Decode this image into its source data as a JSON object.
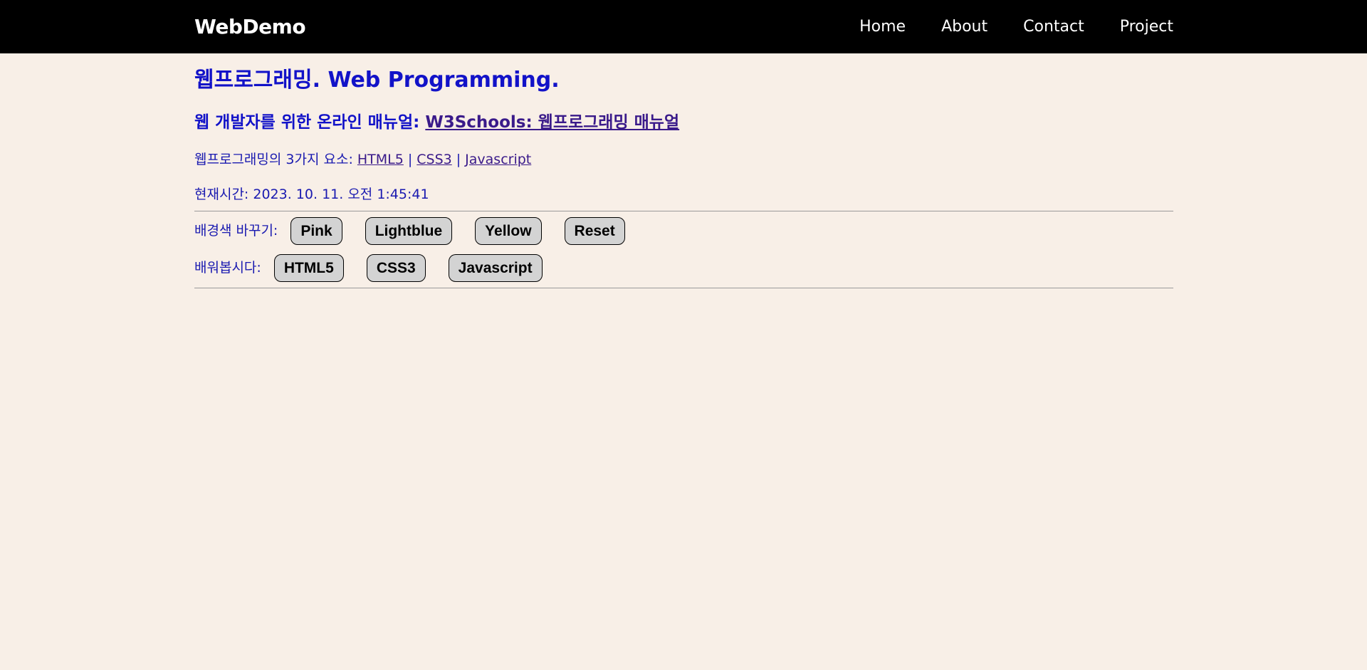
{
  "header": {
    "brand": "WebDemo",
    "nav": [
      "Home",
      "About",
      "Contact",
      "Project"
    ]
  },
  "main": {
    "title": "웹프로그래밍. Web Programming.",
    "subtitle_prefix": "웹 개발자를 위한 온라인 매뉴얼: ",
    "subtitle_link": "W3Schools: 웹프로그래밍 매뉴얼",
    "elements_label": "웹프로그래밍의 3가지 요소: ",
    "elements_links": [
      "HTML5",
      "CSS3",
      "Javascript"
    ],
    "separator": "|",
    "clock_label": "현재시간: ",
    "clock_value": "2023. 10. 11. 오전 1:45:41"
  },
  "bg_controls": {
    "label": "배경색 바꾸기:",
    "buttons": [
      "Pink",
      "Lightblue",
      "Yellow",
      "Reset"
    ]
  },
  "learn_controls": {
    "label": "배워봅시다:",
    "buttons": [
      "HTML5",
      "CSS3",
      "Javascript"
    ]
  },
  "colors": {
    "background": "#f8efe7",
    "header_bg": "#000000",
    "text": "#1212c8",
    "link": "#3a1a8a",
    "button_bg": "#d3d3d3"
  }
}
